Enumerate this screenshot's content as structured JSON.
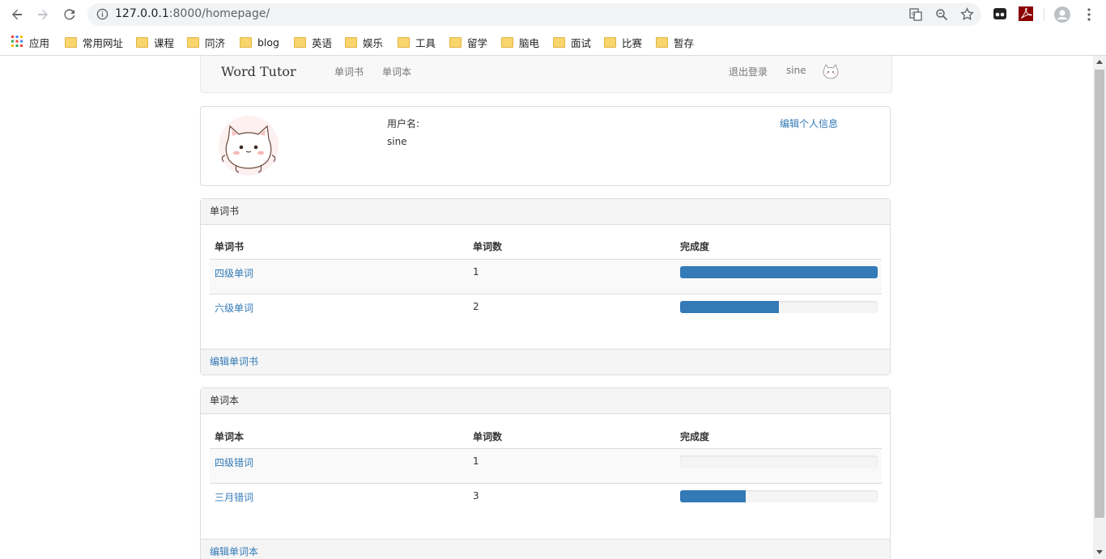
{
  "browser": {
    "url_host": "127.0.0.1",
    "url_path": ":8000/homepage/",
    "bookmarks": [
      {
        "label": "应用"
      },
      {
        "label": "常用网址"
      },
      {
        "label": "课程"
      },
      {
        "label": "同济"
      },
      {
        "label": "blog"
      },
      {
        "label": "英语"
      },
      {
        "label": "娱乐"
      },
      {
        "label": "工具"
      },
      {
        "label": "留学"
      },
      {
        "label": "脑电"
      },
      {
        "label": "面试"
      },
      {
        "label": "比赛"
      },
      {
        "label": "暂存"
      }
    ]
  },
  "navbar": {
    "brand": "Word Tutor",
    "links": [
      "单词书",
      "单词本"
    ],
    "logout": "退出登录",
    "username": "sine"
  },
  "profile": {
    "username_label": "用户名:",
    "username": "sine",
    "edit_link": "编辑个人信息"
  },
  "wordbooks": {
    "heading": "单词书",
    "columns": [
      "单词书",
      "单词数",
      "完成度"
    ],
    "rows": [
      {
        "name": "四级单词",
        "count": "1",
        "progress": 1.0
      },
      {
        "name": "六级单词",
        "count": "2",
        "progress": 0.5
      }
    ],
    "footer_link": "编辑单词书"
  },
  "notebooks": {
    "heading": "单词本",
    "columns": [
      "单词本",
      "单词数",
      "完成度"
    ],
    "rows": [
      {
        "name": "四级错词",
        "count": "1",
        "progress": 0.0
      },
      {
        "name": "三月错词",
        "count": "3",
        "progress": 0.33
      }
    ],
    "footer_link": "编辑单词本"
  },
  "colors": {
    "accent": "#337ab7",
    "link": "#337ab7",
    "panel_bg": "#f5f5f5"
  }
}
